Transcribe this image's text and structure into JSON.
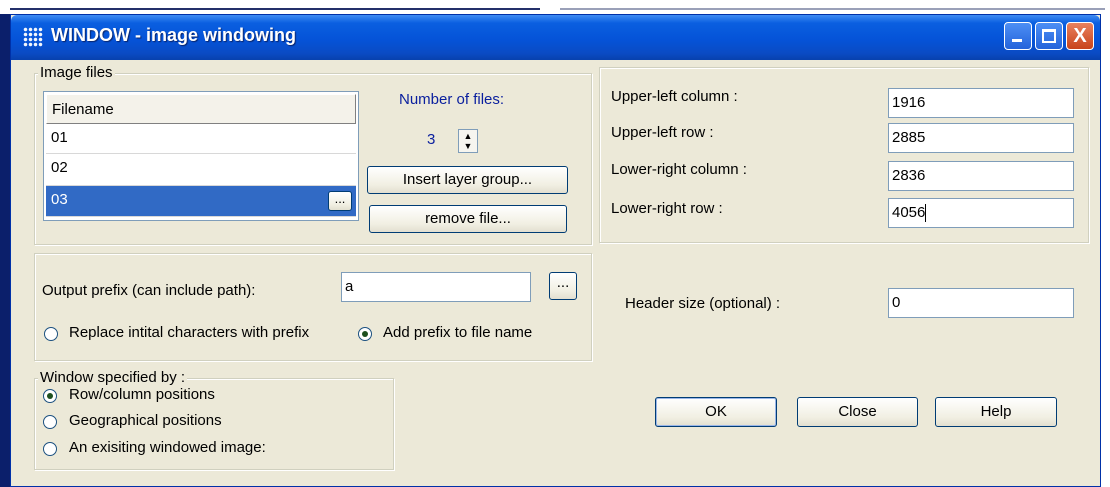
{
  "window": {
    "title": "WINDOW - image windowing",
    "close_glyph": "X"
  },
  "image_files": {
    "legend": "Image files",
    "column_header": "Filename",
    "rows": [
      "01",
      "02",
      "03"
    ],
    "selected_index": 2,
    "browse_label": "...",
    "number_of_files_label": "Number of files:",
    "number_of_files_value": "3",
    "insert_button_label": "Insert layer group...",
    "remove_button_label": "remove file..."
  },
  "coordinates": {
    "fields": [
      {
        "label": "Upper-left column :",
        "value": "1916"
      },
      {
        "label": "Upper-left row :",
        "value": "2885"
      },
      {
        "label": "Lower-right column :",
        "value": "2836"
      },
      {
        "label": "Lower-right row :",
        "value": "4056"
      }
    ]
  },
  "output": {
    "prefix_label": "Output prefix (can include path):",
    "prefix_value": "a",
    "browse_label": "...",
    "replace_option_label": "Replace intital characters with prefix",
    "add_option_label": "Add prefix to file name",
    "selected_option": "add"
  },
  "window_spec": {
    "legend": "Window specified by :",
    "options": [
      {
        "label": "Row/column positions",
        "checked": true
      },
      {
        "label": "Geographical positions",
        "checked": false
      },
      {
        "label": "An exisiting windowed image:",
        "checked": false
      }
    ]
  },
  "header": {
    "label": "Header size (optional) :",
    "value": "0"
  },
  "buttons": {
    "ok": "OK",
    "close": "Close",
    "help": "Help"
  },
  "colors": {
    "titlebar": "#0553d8",
    "selection": "#316ac5",
    "dialog_bg": "#ece9d8",
    "label_blue": "#0a1f9e"
  }
}
